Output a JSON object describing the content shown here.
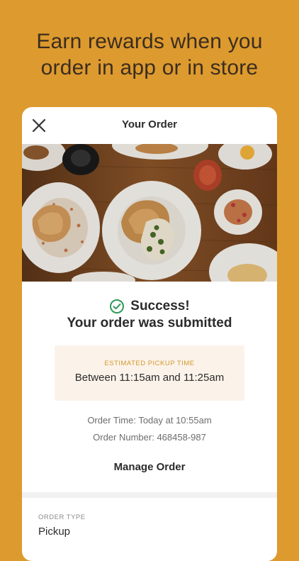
{
  "promo": {
    "line1": "Earn rewards when you",
    "line2": "order in app or in store"
  },
  "header": {
    "title": "Your Order"
  },
  "success": {
    "title": "Success!",
    "subtitle": "Your order was submitted"
  },
  "pickup": {
    "label": "ESTIMATED PICKUP TIME",
    "value": "Between 11:15am and 11:25am"
  },
  "order": {
    "time": "Order Time: Today at 10:55am",
    "number": "Order Number: 468458-987"
  },
  "actions": {
    "manage_label": "Manage Order"
  },
  "order_type": {
    "label": "ORDER TYPE",
    "value": "Pickup"
  },
  "colors": {
    "background": "#DD9A2E",
    "accent": "#D4972E",
    "success": "#2E9A5A",
    "pickup_box": "#FBF3EA"
  },
  "icons": {
    "close": "close-icon",
    "success": "check-circle-icon"
  }
}
